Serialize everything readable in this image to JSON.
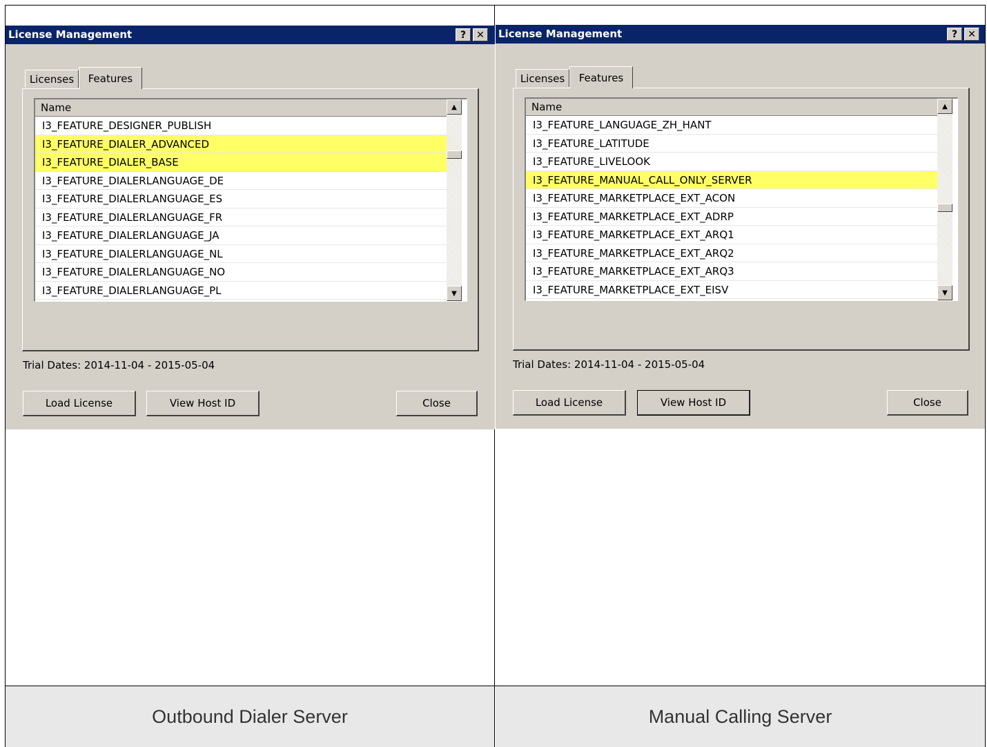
{
  "panels": [
    {
      "caption": "Outbound Dialer Server",
      "dialog": {
        "title": "License Management",
        "help_label": "?",
        "close_label": "✕",
        "tabs": [
          {
            "label": "Licenses",
            "active": false
          },
          {
            "label": "Features",
            "active": true
          }
        ],
        "list": {
          "column_header": "Name",
          "rows": [
            {
              "name": "I3_FEATURE_DESIGNER_PUBLISH",
              "highlighted": false
            },
            {
              "name": "I3_FEATURE_DIALER_ADVANCED",
              "highlighted": true
            },
            {
              "name": "I3_FEATURE_DIALER_BASE",
              "highlighted": true
            },
            {
              "name": "I3_FEATURE_DIALERLANGUAGE_DE",
              "highlighted": false
            },
            {
              "name": "I3_FEATURE_DIALERLANGUAGE_ES",
              "highlighted": false
            },
            {
              "name": "I3_FEATURE_DIALERLANGUAGE_FR",
              "highlighted": false
            },
            {
              "name": "I3_FEATURE_DIALERLANGUAGE_JA",
              "highlighted": false
            },
            {
              "name": "I3_FEATURE_DIALERLANGUAGE_NL",
              "highlighted": false
            },
            {
              "name": "I3_FEATURE_DIALERLANGUAGE_NO",
              "highlighted": false
            },
            {
              "name": "I3_FEATURE_DIALERLANGUAGE_PL",
              "highlighted": false
            }
          ],
          "scroll_position": 0.22
        },
        "trial_dates": "Trial Dates: 2014-11-04 - 2015-05-04",
        "buttons": {
          "load_license": "Load License",
          "view_host_id": "View Host ID",
          "close": "Close"
        },
        "default_button": "none"
      }
    },
    {
      "caption": "Manual Calling Server",
      "dialog": {
        "title": "License Management",
        "help_label": "?",
        "close_label": "✕",
        "tabs": [
          {
            "label": "Licenses",
            "active": false
          },
          {
            "label": "Features",
            "active": true
          }
        ],
        "list": {
          "column_header": "Name",
          "rows": [
            {
              "name": "I3_FEATURE_LANGUAGE_ZH_HANT",
              "highlighted": false
            },
            {
              "name": "I3_FEATURE_LATITUDE",
              "highlighted": false
            },
            {
              "name": "I3_FEATURE_LIVELOOK",
              "highlighted": false
            },
            {
              "name": "I3_FEATURE_MANUAL_CALL_ONLY_SERVER",
              "highlighted": true
            },
            {
              "name": "I3_FEATURE_MARKETPLACE_EXT_ACON",
              "highlighted": false
            },
            {
              "name": "I3_FEATURE_MARKETPLACE_EXT_ADRP",
              "highlighted": false
            },
            {
              "name": "I3_FEATURE_MARKETPLACE_EXT_ARQ1",
              "highlighted": false
            },
            {
              "name": "I3_FEATURE_MARKETPLACE_EXT_ARQ2",
              "highlighted": false
            },
            {
              "name": "I3_FEATURE_MARKETPLACE_EXT_ARQ3",
              "highlighted": false
            },
            {
              "name": "I3_FEATURE_MARKETPLACE_EXT_EISV",
              "highlighted": false
            }
          ],
          "scroll_position": 0.55
        },
        "trial_dates": "Trial Dates: 2014-11-04 - 2015-05-04",
        "buttons": {
          "load_license": "Load License",
          "view_host_id": "View Host ID",
          "close": "Close"
        },
        "default_button": "view_host_id"
      }
    }
  ],
  "colors": {
    "titlebar": "#0a246a",
    "dialog_face": "#d4d0c8",
    "highlight_row": "#ffff66",
    "caption_bg": "#e8e8e8"
  },
  "icons": {
    "scroll_up": "up-arrow-icon",
    "scroll_down": "down-arrow-icon",
    "help": "help-icon",
    "close": "close-icon"
  }
}
